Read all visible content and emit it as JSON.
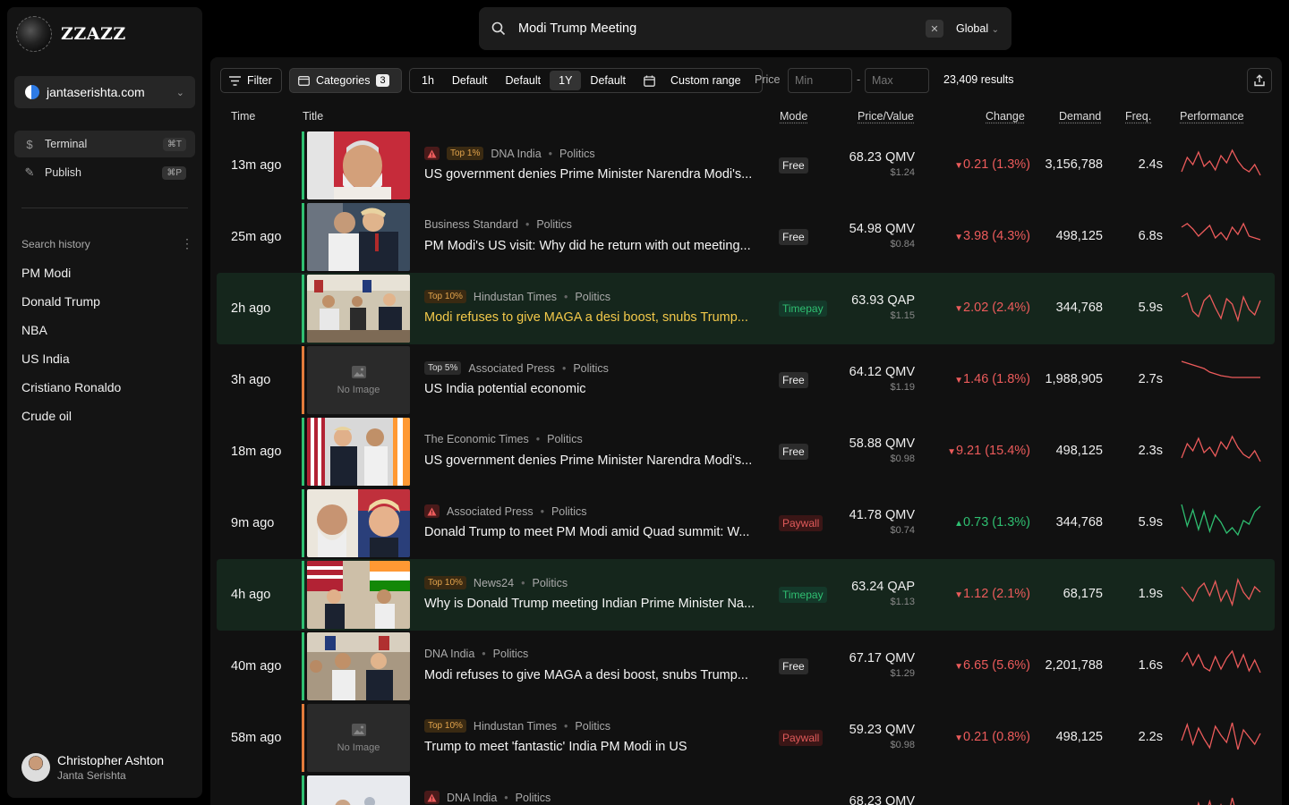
{
  "brand": {
    "name": "ZZAZZ"
  },
  "site": {
    "label": "jantaserishta.com"
  },
  "nav": [
    {
      "label": "Terminal",
      "shortcut": "⌘T"
    },
    {
      "label": "Publish",
      "shortcut": "⌘P"
    }
  ],
  "history": {
    "title": "Search history",
    "items": [
      "PM Modi",
      "Donald Trump",
      "NBA",
      "US India",
      "Cristiano Ronaldo",
      "Crude oil"
    ]
  },
  "user": {
    "name": "Christopher Ashton",
    "org": "Janta Serishta"
  },
  "search": {
    "query": "Modi Trump Meeting",
    "scope": "Global"
  },
  "toolbar": {
    "filter": "Filter",
    "categories": "Categories",
    "categories_count": "3",
    "ranges": [
      "1h",
      "Default",
      "Default",
      "1Y",
      "Default"
    ],
    "custom": "Custom range",
    "price": "Price",
    "min_placeholder": "Min",
    "max_placeholder": "Max",
    "results": "23,409 results"
  },
  "columns": {
    "time": "Time",
    "title": "Title",
    "mode": "Mode",
    "price": "Price/Value",
    "change": "Change",
    "demand": "Demand",
    "freq": "Freq.",
    "performance": "Performance"
  },
  "no_image": "No Image",
  "colors": {
    "green": "#2fbf71",
    "red": "#ec5b5b",
    "yellow": "#f3c94a",
    "orange": "#e27b3b"
  },
  "rows": [
    {
      "time": "13m ago",
      "warn": true,
      "tag": "Top 1%",
      "source": "DNA India",
      "category": "Politics",
      "title": "US government denies Prime Minister Narendra Modi's...",
      "mode": "Free",
      "price": "68.23 QMV",
      "usd": "$1.24",
      "change": "0.21 (1.3%)",
      "dir": "down",
      "demand": "3,156,788",
      "freq": "2.4s",
      "bar": "green",
      "img": "modi"
    },
    {
      "time": "25m ago",
      "warn": false,
      "tag": "",
      "source": "Business Standard",
      "category": "Politics",
      "title": "PM Modi's US visit: Why did he return with out meeting...",
      "mode": "Free",
      "price": "54.98 QMV",
      "usd": "$0.84",
      "change": "3.98 (4.3%)",
      "dir": "down",
      "demand": "498,125",
      "freq": "6.8s",
      "bar": "green",
      "img": "hug"
    },
    {
      "time": "2h ago",
      "warn": false,
      "tag": "Top 10%",
      "source": "Hindustan Times",
      "category": "Politics",
      "title": "Modi refuses to give MAGA a desi boost, snubs Trump...",
      "mode": "Timepay",
      "price": "63.93 QAP",
      "usd": "$1.15",
      "change": "2.02 (2.4%)",
      "dir": "down",
      "demand": "344,768",
      "freq": "5.9s",
      "bar": "green",
      "img": "meeting",
      "highlight": true
    },
    {
      "time": "3h ago",
      "warn": false,
      "tag": "Top 5%",
      "source": "Associated Press",
      "category": "Politics",
      "title": "US India potential economic",
      "mode": "Free",
      "price": "64.12 QMV",
      "usd": "$1.19",
      "change": "1.46 (1.8%)",
      "dir": "down",
      "demand": "1,988,905",
      "freq": "2.7s",
      "bar": "orange",
      "img": "none"
    },
    {
      "time": "18m ago",
      "warn": false,
      "tag": "",
      "source": "The Economic Times",
      "category": "Politics",
      "title": "US government denies Prime Minister Narendra Modi's...",
      "mode": "Free",
      "price": "58.88 QMV",
      "usd": "$0.98",
      "change": "9.21 (15.4%)",
      "dir": "down",
      "demand": "498,125",
      "freq": "2.3s",
      "bar": "green",
      "img": "flags"
    },
    {
      "time": "9m ago",
      "warn": true,
      "tag": "",
      "source": "Associated Press",
      "category": "Politics",
      "title": "Donald Trump to meet PM Modi amid Quad summit: W...",
      "mode": "Paywall",
      "price": "41.78 QMV",
      "usd": "$0.74",
      "change": "0.73 (1.3%)",
      "dir": "up",
      "demand": "344,768",
      "freq": "5.9s",
      "bar": "green",
      "img": "split"
    },
    {
      "time": "4h ago",
      "warn": false,
      "tag": "Top 10%",
      "source": "News24",
      "category": "Politics",
      "title": "Why is Donald Trump meeting Indian Prime Minister Na...",
      "mode": "Timepay",
      "price": "63.24 QAP",
      "usd": "$1.13",
      "change": "1.12 (2.1%)",
      "dir": "down",
      "demand": "68,175",
      "freq": "1.9s",
      "bar": "green",
      "img": "flags2",
      "highlight": true
    },
    {
      "time": "40m ago",
      "warn": false,
      "tag": "",
      "source": "DNA India",
      "category": "Politics",
      "title": "Modi refuses to give MAGA a desi boost, snubs Trump...",
      "mode": "Free",
      "price": "67.17 QMV",
      "usd": "$1.29",
      "change": "6.65 (5.6%)",
      "dir": "down",
      "demand": "2,201,788",
      "freq": "1.6s",
      "bar": "green",
      "img": "meeting2"
    },
    {
      "time": "58m ago",
      "warn": false,
      "tag": "Top 10%",
      "source": "Hindustan Times",
      "category": "Politics",
      "title": "Trump to meet 'fantastic' India PM Modi in US",
      "mode": "Paywall",
      "price": "59.23 QMV",
      "usd": "$0.98",
      "change": "0.21 (0.8%)",
      "dir": "down",
      "demand": "498,125",
      "freq": "2.2s",
      "bar": "orange",
      "img": "none"
    },
    {
      "time": "",
      "warn": true,
      "tag": "",
      "source": "DNA India",
      "category": "Politics",
      "title": "",
      "mode": "",
      "price": "68.23 QMV",
      "usd": "",
      "change": "",
      "dir": "down",
      "demand": "",
      "freq": "",
      "bar": "green",
      "img": "light"
    }
  ]
}
